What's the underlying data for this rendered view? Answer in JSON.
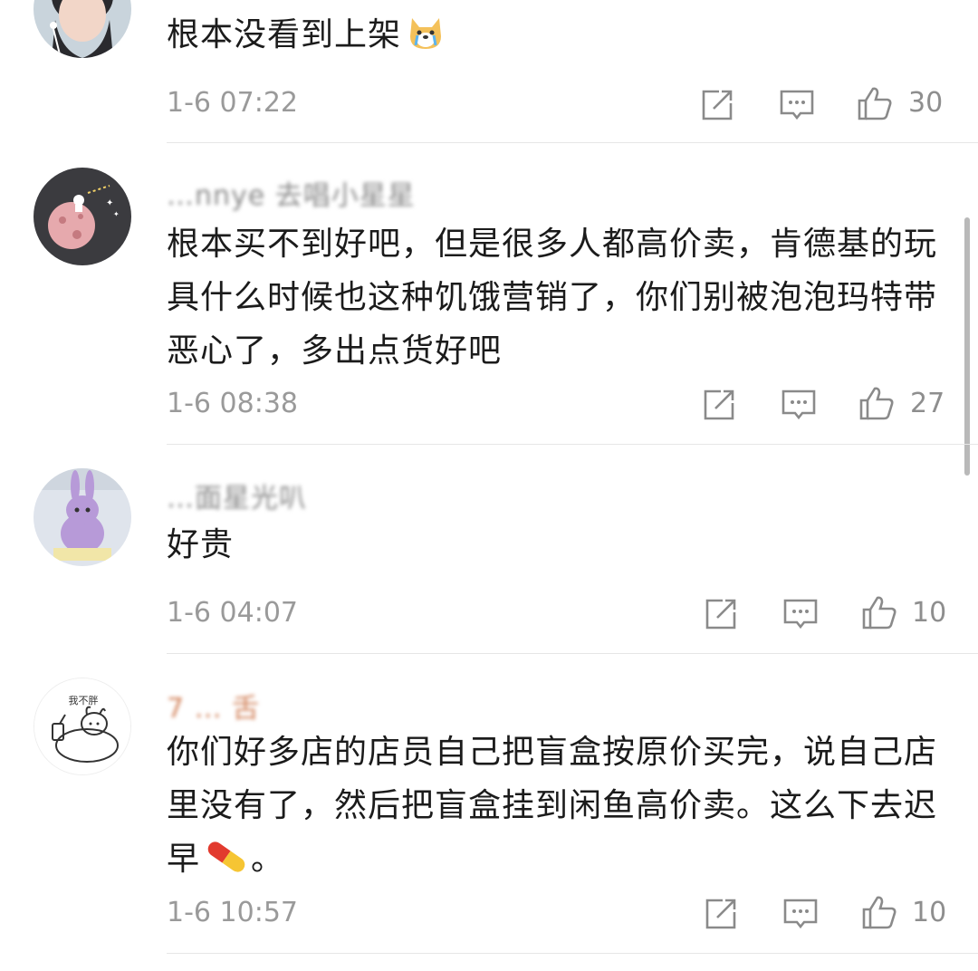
{
  "comments": [
    {
      "username": "",
      "text": "根本没看到上架",
      "emoji": "crying-dog-emoji",
      "time": "1-6 07:22",
      "likes": "30"
    },
    {
      "username": "…nnye 去唱小星星",
      "text": "根本买不到好吧，但是很多人都高价卖，肯德基的玩具什么时候也这种饥饿营销了，你们别被泡泡玛特带恶心了，多出点货好吧",
      "time": "1-6 08:38",
      "likes": "27"
    },
    {
      "username": "…面星光叭",
      "text": "好贵",
      "time": "1-6 04:07",
      "likes": "10"
    },
    {
      "username": "7 … 舌",
      "text": "你们好多店的店员自己把盲盒按原价买完，说自己店里没有了，然后把盲盒挂到闲鱼高价卖。这么下去迟早",
      "text_end": "。",
      "emoji": "pill-emoji",
      "time": "1-6 10:57",
      "likes": "10"
    }
  ],
  "avatar4_caption": "我不胖"
}
